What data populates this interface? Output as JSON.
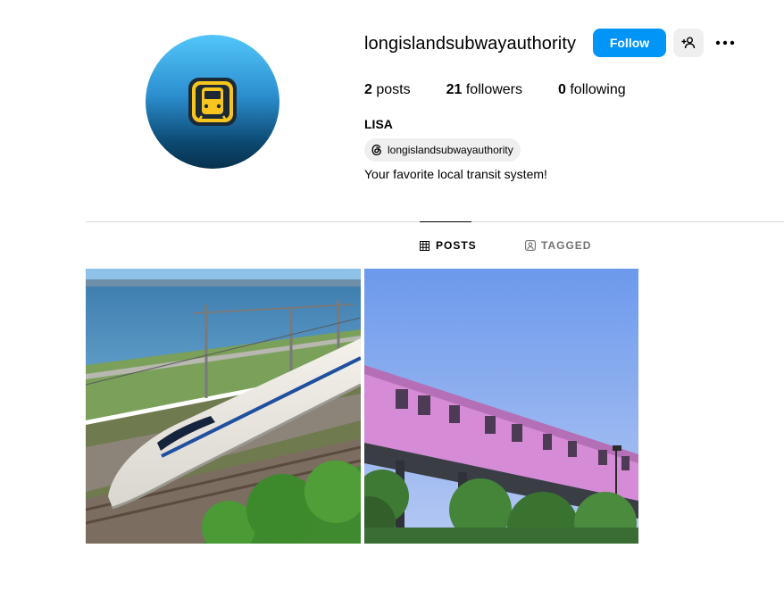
{
  "profile": {
    "username": "longislandsubwayauthority",
    "follow_label": "Follow",
    "stats": [
      {
        "count": "2",
        "label": "posts"
      },
      {
        "count": "21",
        "label": "followers"
      },
      {
        "count": "0",
        "label": "following"
      }
    ],
    "full_name": "LISA",
    "threads_handle": "longislandsubwayauthority",
    "bio": "Your favorite local transit system!"
  },
  "tabs": [
    {
      "label": "POSTS",
      "icon": "grid-icon",
      "active": true
    },
    {
      "label": "TAGGED",
      "icon": "tag-user-icon",
      "active": false
    }
  ],
  "posts": [
    {
      "description": "white bullet train by the sea"
    },
    {
      "description": "pink elevated train"
    }
  ],
  "colors": {
    "accent": "#0095f6",
    "secondary_button": "#efefef",
    "divider": "#dbdbdb",
    "muted_text": "#737373"
  }
}
